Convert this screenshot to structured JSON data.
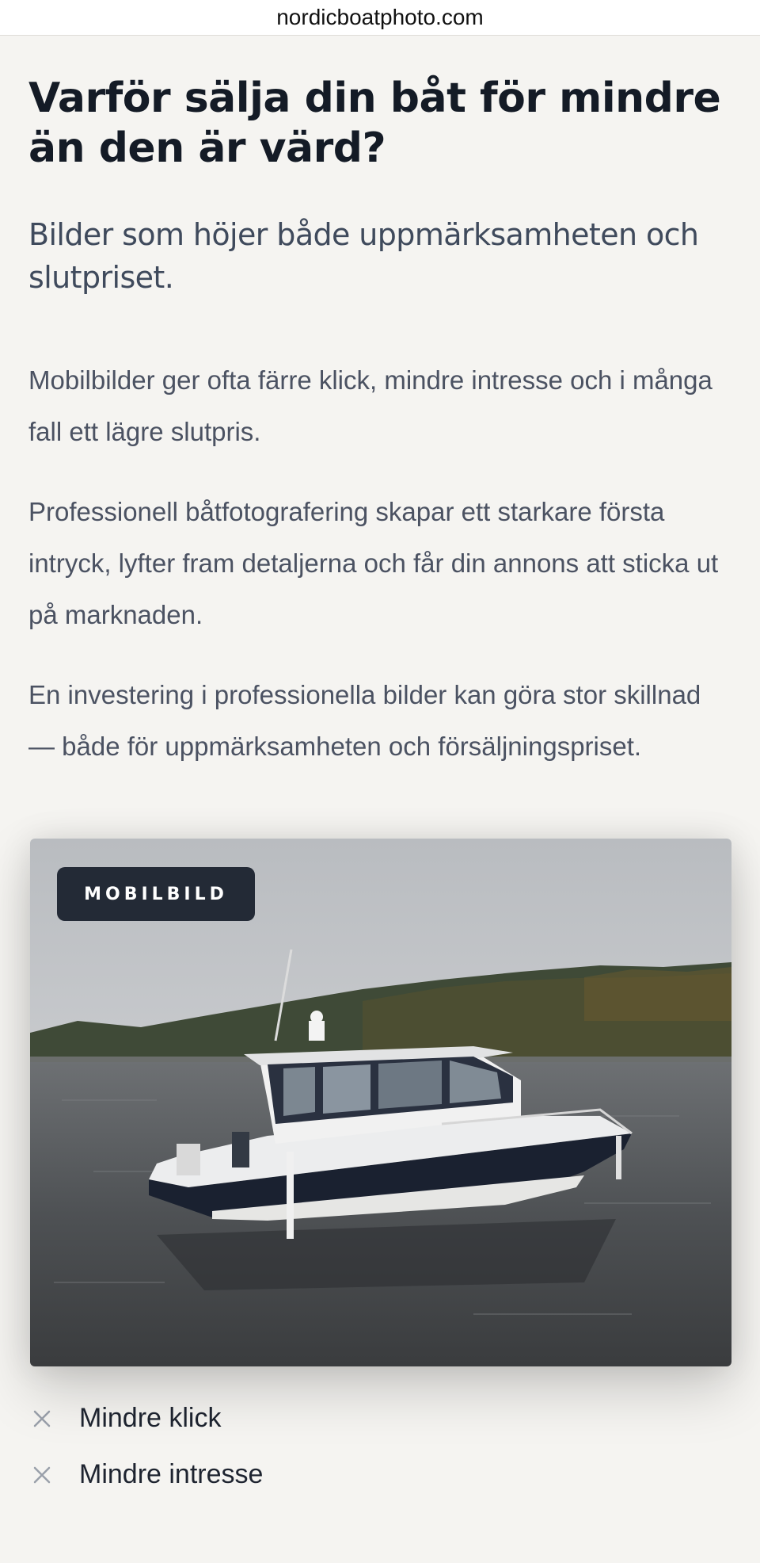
{
  "browser": {
    "url": "nordicboatphoto.com"
  },
  "page": {
    "title": "Varför sälja din båt för mindre än den är värd?",
    "subtitle": "Bilder som höjer både uppmärksamheten och slutpriset.",
    "paragraphs": [
      "Mobilbilder ger ofta färre klick, mindre intresse och i många fall ett lägre slutpris.",
      "Professionell båtfotografering skapar ett starkare första intryck, lyfter fram detaljerna och får din annons att sticka ut på marknaden.",
      "En investering i professionella bilder kan göra stor skillnad — både för uppmärksamheten och försäljningspriset."
    ]
  },
  "photo_card": {
    "badge": "MOBILBILD",
    "photo_subject": "boat-on-water-photo"
  },
  "drawbacks": [
    {
      "icon": "x-icon",
      "label": "Mindre klick"
    },
    {
      "icon": "x-icon",
      "label": "Mindre intresse"
    }
  ],
  "colors": {
    "background": "#f5f4f1",
    "heading": "#141b26",
    "badge_bg": "#232a36",
    "text_muted": "#4b5262"
  }
}
